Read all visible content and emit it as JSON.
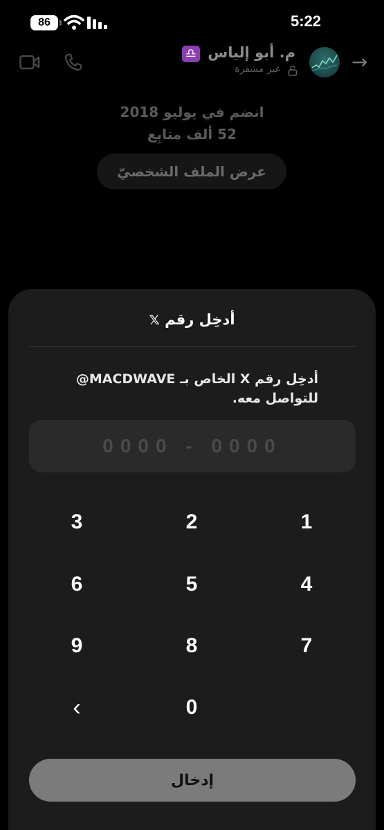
{
  "status_bar": {
    "time": "5:22",
    "battery": "86"
  },
  "header": {
    "contact_name": "م. أبو إلياس",
    "encryption_status": "غير مشفرة",
    "libra_emoji": "♎"
  },
  "profile": {
    "joined": "انضم في يوليو 2018",
    "followers": "52 ألف متابِع",
    "view_profile_label": "عرض الملف الشخصيّ"
  },
  "sheet": {
    "title": "أدخِل رقم",
    "title_x": "𝕏",
    "instruction": "أدخِل رقم X الخاص بـ MACDWAVE@ للتواصل معه.",
    "code_placeholder": "0000 - 0000",
    "submit_label": "إدخال"
  },
  "keypad": {
    "k1": "1",
    "k2": "2",
    "k3": "3",
    "k4": "4",
    "k5": "5",
    "k6": "6",
    "k7": "7",
    "k8": "8",
    "k9": "9",
    "k0": "0",
    "backspace": "‹"
  },
  "colors": {
    "background": "#000000",
    "sheet": "#1c1c1c",
    "field": "#2a2a2a",
    "submit": "#7b7b7b",
    "libra_badge": "#8a3fb0"
  }
}
